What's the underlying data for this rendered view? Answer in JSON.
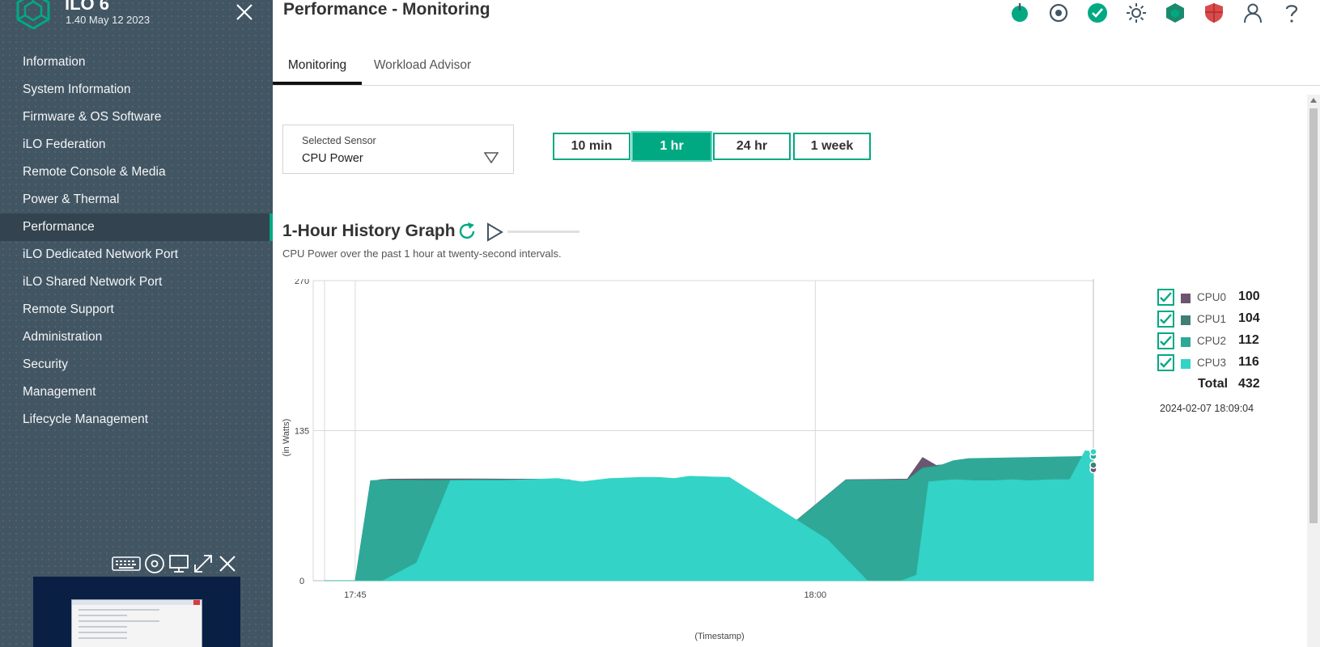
{
  "sidebar": {
    "title": "iLO 6",
    "version": "1.40 May 12 2023",
    "nav": [
      {
        "label": "Information",
        "name": "nav-information"
      },
      {
        "label": "System Information",
        "name": "nav-system-information"
      },
      {
        "label": "Firmware & OS Software",
        "name": "nav-firmware-os-software"
      },
      {
        "label": "iLO Federation",
        "name": "nav-ilo-federation"
      },
      {
        "label": "Remote Console & Media",
        "name": "nav-remote-console-media"
      },
      {
        "label": "Power & Thermal",
        "name": "nav-power-thermal"
      },
      {
        "label": "Performance",
        "name": "nav-performance",
        "active": true
      },
      {
        "label": "iLO Dedicated Network Port",
        "name": "nav-ilo-dedicated-network-port"
      },
      {
        "label": "iLO Shared Network Port",
        "name": "nav-ilo-shared-network-port"
      },
      {
        "label": "Remote Support",
        "name": "nav-remote-support"
      },
      {
        "label": "Administration",
        "name": "nav-administration"
      },
      {
        "label": "Security",
        "name": "nav-security"
      },
      {
        "label": "Management",
        "name": "nav-management"
      },
      {
        "label": "Lifecycle Management",
        "name": "nav-lifecycle-management"
      }
    ],
    "console_tools": [
      "keyboard-icon",
      "disc-icon",
      "monitor-icon",
      "expand-icon",
      "close-icon"
    ]
  },
  "header": {
    "title": "Performance - Monitoring",
    "icons": [
      "power-icon",
      "uid-icon",
      "health-ok-icon",
      "brightness-icon",
      "ilo-security-icon",
      "shield-icon",
      "user-icon",
      "help-icon"
    ]
  },
  "tabs": [
    {
      "label": "Monitoring",
      "active": true
    },
    {
      "label": "Workload Advisor",
      "active": false
    }
  ],
  "sensor": {
    "label": "Selected Sensor",
    "value": "CPU Power"
  },
  "ranges": [
    {
      "label": "10 min",
      "active": false
    },
    {
      "label": "1 hr",
      "active": true
    },
    {
      "label": "24 hr",
      "active": false
    },
    {
      "label": "1 week",
      "active": false
    }
  ],
  "graph": {
    "title": "1-Hour History Graph",
    "subtitle": "CPU Power over the past 1 hour at twenty-second intervals."
  },
  "legend": {
    "items": [
      {
        "name": "CPU0",
        "value": "100",
        "checked": true
      },
      {
        "name": "CPU1",
        "value": "104",
        "checked": true
      },
      {
        "name": "CPU2",
        "value": "112",
        "checked": true
      },
      {
        "name": "CPU3",
        "value": "116",
        "checked": true
      }
    ],
    "total_label": "Total",
    "total_value": "432",
    "timestamp": "2024-02-07 18:09:04"
  },
  "colors": {
    "accent": "#01a982",
    "sidebar_bg": "#425563",
    "cpu0": "#6b5570",
    "cpu1": "#3f7f75",
    "cpu2": "#2fa898",
    "cpu3": "#33d3c7"
  },
  "chart_data": {
    "type": "area",
    "ylabel": "(in Watts)",
    "xlabel": "(Timestamp)",
    "ylim": [
      0,
      270
    ],
    "yticks": [
      0,
      135,
      270
    ],
    "x_start": "17:44:00",
    "x_ticks": [
      {
        "label": "17:45",
        "t": 1
      },
      {
        "label": "18:00",
        "t": 16
      }
    ],
    "x_end_min": 25.07,
    "grid": true,
    "series": [
      {
        "name": "CPU0",
        "color": "#6b5570",
        "x": [
          0,
          1,
          1.5,
          1.8,
          2.2,
          3.5,
          5,
          6,
          7,
          8,
          9,
          10,
          12,
          13,
          17,
          19,
          19.5,
          20,
          20.5,
          21,
          25.07
        ],
        "y": [
          0,
          0,
          88,
          91,
          91.5,
          91.6,
          91.6,
          91.5,
          91.5,
          89.5,
          0,
          0,
          0,
          0,
          91,
          91.5,
          111,
          103,
          104,
          103.5,
          100
        ]
      },
      {
        "name": "CPU1",
        "color": "#3f7f75",
        "x": [
          0,
          1,
          1.5,
          1.8,
          2.2,
          3.5,
          5,
          6,
          7,
          8,
          9,
          10,
          12,
          13,
          17,
          19,
          19.5,
          20,
          20.5,
          21,
          25.07
        ],
        "y": [
          0,
          0,
          89,
          90.5,
          90.5,
          91,
          90.5,
          90.5,
          91,
          89,
          0,
          0,
          0,
          0,
          90.5,
          91,
          102,
          104,
          105,
          105.5,
          104
        ]
      },
      {
        "name": "CPU2",
        "color": "#2fa898",
        "x": [
          0,
          1,
          1.5,
          1.8,
          2.2,
          3.5,
          5,
          6,
          7,
          8,
          9,
          10,
          12,
          13,
          17,
          19,
          19.5,
          20,
          20.5,
          21,
          25.07
        ],
        "y": [
          0,
          0,
          90,
          90.5,
          90.5,
          90,
          91,
          91,
          90.5,
          91,
          0,
          0,
          0,
          0,
          90.5,
          90.5,
          101,
          103,
          108,
          110,
          112
        ]
      },
      {
        "name": "CPU3",
        "color": "#33d3c7",
        "x": [
          0,
          0.3,
          0.9,
          1.9,
          3.0,
          4.1,
          4.9,
          5.8,
          6.5,
          7.6,
          8.4,
          9.3,
          10.3,
          10.9,
          11.4,
          11.9,
          13.2,
          16.4,
          17.7,
          18.3,
          18.8,
          19.3,
          19.7,
          20.1,
          20.6,
          21.2,
          21.8,
          22.4,
          23.0,
          23.7,
          24.3,
          24.8,
          25.07
        ],
        "y": [
          0,
          0,
          0,
          0,
          16,
          90,
          90,
          90,
          91,
          92,
          89,
          92,
          93,
          93,
          92,
          94,
          93,
          37,
          0,
          0,
          0,
          5,
          89,
          90,
          91,
          90,
          90,
          91,
          90,
          91,
          91,
          117,
          116
        ]
      }
    ]
  }
}
